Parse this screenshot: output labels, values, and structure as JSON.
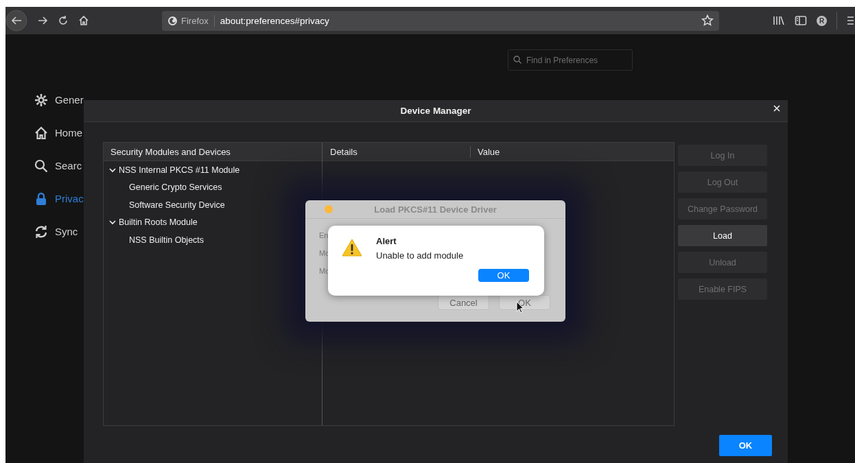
{
  "browser": {
    "identity_label": "Firefox",
    "url": "about:preferences#privacy",
    "account_initial": "R"
  },
  "preferences": {
    "search": {
      "placeholder": "Find in Preferences"
    },
    "sidebar": {
      "items": [
        {
          "kind": "gear",
          "label": "Gener",
          "selected": false
        },
        {
          "kind": "home",
          "label": "Home",
          "selected": false
        },
        {
          "kind": "search",
          "label": "Searc",
          "selected": false
        },
        {
          "kind": "lock",
          "label": "Privac",
          "selected": true
        },
        {
          "kind": "sync",
          "label": "Sync",
          "selected": false
        }
      ]
    }
  },
  "device_manager": {
    "title": "Device Manager",
    "columns": [
      "Security Modules and Devices",
      "Details",
      "Value"
    ],
    "tree": [
      {
        "label": "NSS Internal PKCS #11 Module",
        "expanded": true,
        "children": [
          {
            "label": "Generic Crypto Services"
          },
          {
            "label": "Software Security Device"
          }
        ]
      },
      {
        "label": "Builtin Roots Module",
        "expanded": true,
        "children": [
          {
            "label": "NSS Builtin Objects"
          }
        ]
      }
    ],
    "buttons": [
      {
        "label": "Log In",
        "disabled": true
      },
      {
        "label": "Log Out",
        "disabled": true
      },
      {
        "label": "Change Password",
        "disabled": true
      },
      {
        "label": "Load",
        "disabled": false
      },
      {
        "label": "Unload",
        "disabled": true
      },
      {
        "label": "Enable FIPS",
        "disabled": true
      }
    ],
    "ok_button": "OK"
  },
  "load_dialog": {
    "title": "Load PKCS#11 Device Driver",
    "field_labels": [
      "En",
      "Mo",
      "Mo"
    ],
    "buttons": [
      "Cancel",
      "OK"
    ]
  },
  "alert": {
    "title": "Alert",
    "message": "Unable to add module",
    "button": "OK"
  }
}
